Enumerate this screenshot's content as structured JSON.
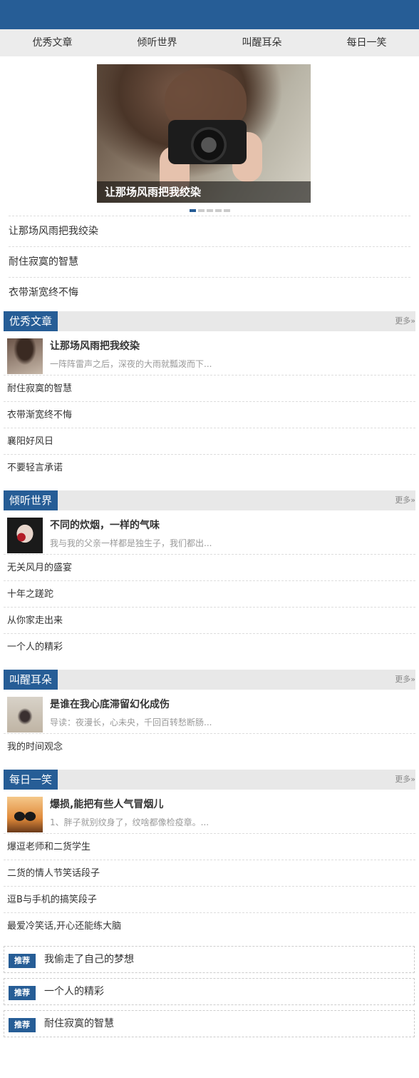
{
  "nav": [
    "优秀文章",
    "倾听世界",
    "叫醒耳朵",
    "每日一笑"
  ],
  "slider": {
    "caption": "让那场风雨把我绞染",
    "dots": 5,
    "active_dot": 1
  },
  "toplist": [
    "让那场风雨把我绞染",
    "耐住寂寞的智慧",
    "衣带渐宽终不悔"
  ],
  "more_label": "更多»",
  "sections": [
    {
      "title": "优秀文章",
      "feat_title": "让那场风雨把我绞染",
      "feat_sub": "一阵阵雷声之后，深夜的大雨就瓢泼而下...",
      "rows": [
        "耐住寂寞的智慧",
        "衣带渐宽终不悔",
        "襄阳好风日",
        "不要轻言承诺"
      ]
    },
    {
      "title": "倾听世界",
      "feat_title": "不同的炊烟，一样的气味",
      "feat_sub": "我与我的父亲一样都是独生子，我们都出...",
      "rows": [
        "无关风月的盛宴",
        "十年之蹉跎",
        "从你家走出来",
        "一个人的精彩"
      ]
    },
    {
      "title": "叫醒耳朵",
      "feat_title": "是谁在我心底滞留幻化成伤",
      "feat_sub": "导读：夜漫长，心未央，千回百转愁断肠...",
      "rows": [
        "我的时间观念"
      ]
    },
    {
      "title": "每日一笑",
      "feat_title": "爆损,能把有些人气冒烟儿",
      "feat_sub": "1、胖子就别纹身了，纹啥都像检疫章。...",
      "rows": [
        "爆逗老师和二货学生",
        "二货的情人节笑话段子",
        "逗B与手机的搞笑段子",
        "最爱冷笑话,开心还能练大脑"
      ]
    }
  ],
  "rec_tag": "推荐",
  "recs": [
    "我偷走了自己的梦想",
    "一个人的精彩",
    "耐住寂寞的智慧"
  ],
  "colors": {
    "brand": "#265d96",
    "nav_bg": "#ececec",
    "section_bg": "#e8e8e8"
  }
}
